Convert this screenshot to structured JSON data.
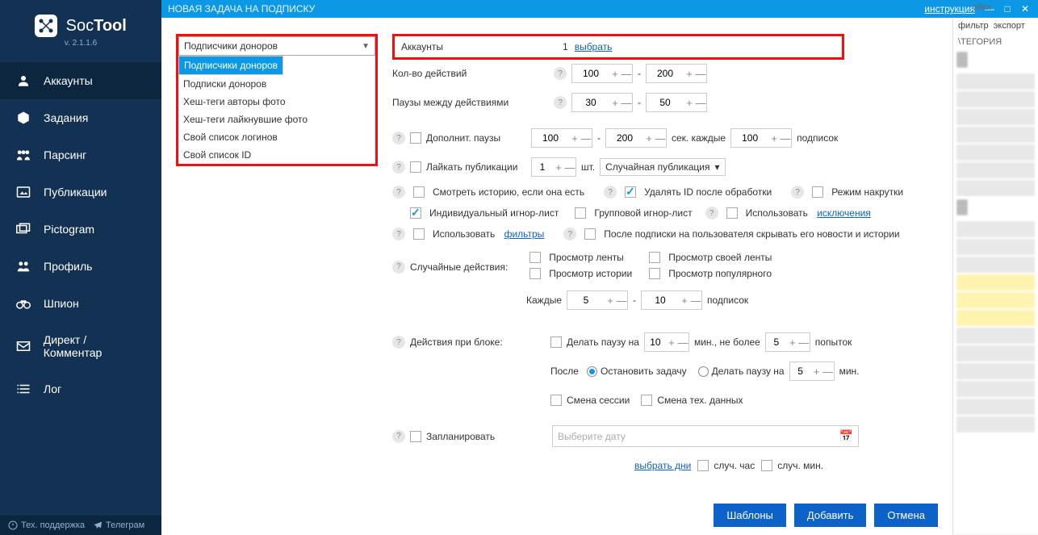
{
  "app": {
    "name_thin": "Soc",
    "name_bold": "Tool",
    "version": "v. 2.1.1.6"
  },
  "sidebar": {
    "items": [
      {
        "label": "Аккаунты"
      },
      {
        "label": "Задания"
      },
      {
        "label": "Парсинг"
      },
      {
        "label": "Публикации"
      },
      {
        "label": "Pictogram"
      },
      {
        "label": "Профиль"
      },
      {
        "label": "Шпион"
      },
      {
        "label": "Директ / Комментар"
      },
      {
        "label": "Лог"
      }
    ],
    "footer": {
      "support": "Тех. поддержка",
      "telegram": "Телеграм"
    }
  },
  "titlebar": {
    "title": "НОВАЯ ЗАДАЧА НА ПОДПИСКУ",
    "help": "инструкция"
  },
  "dropdown": {
    "selected": "Подписчики доноров",
    "options": [
      "Подписчики доноров",
      "Подписки доноров",
      "Хеш-теги авторы фото",
      "Хеш-теги лайкнувшие фото",
      "Свой список логинов",
      "Свой список ID"
    ]
  },
  "accounts": {
    "label": "Аккаунты",
    "count": "1",
    "select": "выбрать"
  },
  "actions": {
    "label": "Кол-во действий",
    "from": "100",
    "to": "200"
  },
  "pauses": {
    "label": "Паузы между действиями",
    "from": "30",
    "to": "50"
  },
  "extra_pause": {
    "label": "Дополнит. паузы",
    "from": "100",
    "to": "200",
    "sec_every": "сек. каждые",
    "every": "100",
    "subs": "подписок"
  },
  "like": {
    "label": "Лайкать публикации",
    "count": "1",
    "pcs": "шт.",
    "mode": "Случайная публикация"
  },
  "story": {
    "label": "Смотреть историю, если она есть"
  },
  "delid": {
    "label": "Удалять ID после обработки"
  },
  "boost": {
    "label": "Режим накрутки"
  },
  "ignore_ind": {
    "label": "Индивидуальный игнор-лист"
  },
  "ignore_grp": {
    "label": "Групповой игнор-лист"
  },
  "excl": {
    "use": "Использовать",
    "link": "исключения"
  },
  "filters": {
    "use": "Использовать",
    "link": "фильтры"
  },
  "hide": {
    "label": "После подписки на пользователя скрывать его новости и истории"
  },
  "random": {
    "label": "Случайные действия:",
    "feed": "Просмотр ленты",
    "ownfeed": "Просмотр своей ленты",
    "history": "Просмотр истории",
    "popular": "Просмотр популярного",
    "every": "Каждые",
    "from": "5",
    "to": "10",
    "subs": "подписок"
  },
  "block": {
    "label": "Действия при блоке:",
    "pause_on": "Делать паузу на",
    "pause_min": "10",
    "min_nomore": "мин., не более",
    "attempts": "5",
    "attempts_lbl": "попыток",
    "after": "После",
    "stop": "Остановить задачу",
    "pause2": "Делать паузу на",
    "pause2_min": "5",
    "min": "мин.",
    "sess": "Смена сессии",
    "tech": "Смена тех. данных"
  },
  "schedule": {
    "label": "Запланировать",
    "placeholder": "Выберите дату",
    "days": "выбрать дни",
    "rhour": "случ. час",
    "rmin": "случ. мин."
  },
  "buttons": {
    "tpl": "Шаблоны",
    "add": "Добавить",
    "cancel": "Отмена"
  },
  "bgwin": {
    "settings": "ойки",
    "filter": "фильтр",
    "export": "экспорт",
    "cat": "\\ТЕГОРИЯ"
  }
}
